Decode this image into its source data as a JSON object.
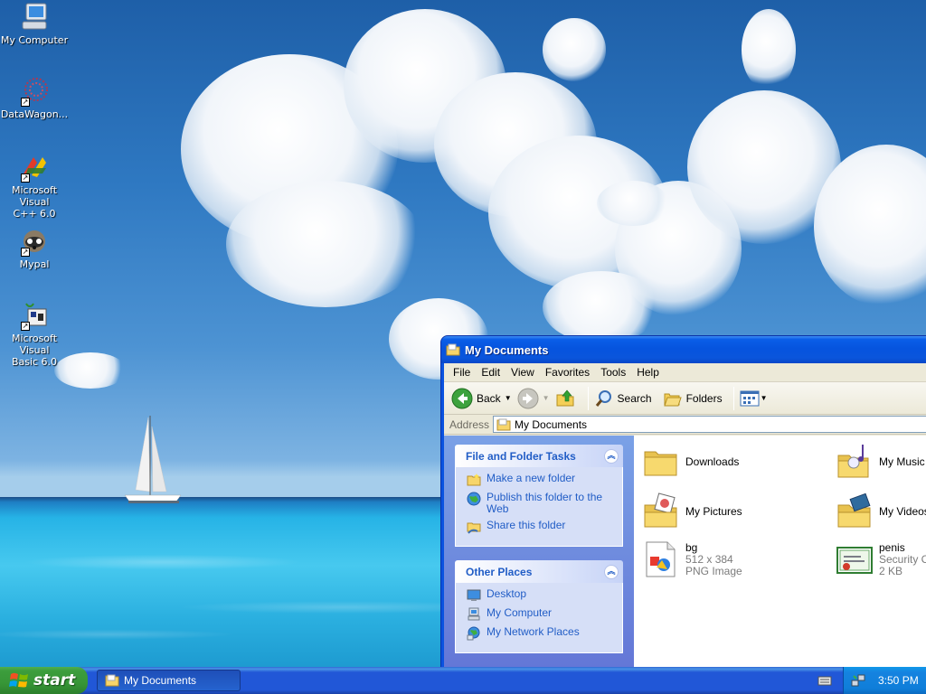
{
  "desktop": {
    "icons": [
      {
        "label": "My Computer",
        "icon": "my-computer-icon"
      },
      {
        "label": "DataWagon...",
        "icon": "datawagon-icon"
      },
      {
        "label_line1": "Microsoft Visual",
        "label_line2": "C++ 6.0",
        "icon": "visual-cpp-icon"
      },
      {
        "label": "Mypal",
        "icon": "mypal-icon"
      },
      {
        "label_line1": "Microsoft Visual",
        "label_line2": "Basic 6.0",
        "icon": "visual-basic-icon"
      }
    ]
  },
  "window": {
    "title": "My Documents",
    "menu": [
      "File",
      "Edit",
      "View",
      "Favorites",
      "Tools",
      "Help"
    ],
    "toolbar": {
      "back_label": "Back",
      "search_label": "Search",
      "folders_label": "Folders"
    },
    "address": {
      "label": "Address",
      "value": "My Documents"
    },
    "tasks_panel": {
      "title": "File and Folder Tasks",
      "items": [
        {
          "label": "Make a new folder",
          "icon": "new-folder-icon"
        },
        {
          "label": "Publish this folder to the Web",
          "icon": "publish-web-icon"
        },
        {
          "label": "Share this folder",
          "icon": "share-folder-icon"
        }
      ]
    },
    "places_panel": {
      "title": "Other Places",
      "items": [
        {
          "label": "Desktop",
          "icon": "desktop-icon"
        },
        {
          "label": "My Computer",
          "icon": "my-computer-icon"
        },
        {
          "label": "My Network Places",
          "icon": "network-places-icon"
        }
      ]
    },
    "files": [
      {
        "name": "Downloads",
        "type": "folder"
      },
      {
        "name": "My Music",
        "type": "music-folder"
      },
      {
        "name": "My Pictures",
        "type": "pictures-folder"
      },
      {
        "name": "My Videos",
        "type": "videos-folder"
      },
      {
        "name": "bg",
        "meta1": "512 x 384",
        "meta2": "PNG Image",
        "type": "png-file"
      },
      {
        "name": "penis",
        "meta1": "Security C",
        "meta2": "2 KB",
        "type": "certificate-file"
      }
    ]
  },
  "taskbar": {
    "start_label": "start",
    "task_button_label": "My Documents",
    "clock": "3:50 PM"
  },
  "colors": {
    "xp_blue": "#0a53e0",
    "task_link": "#215dc6",
    "start_green": "#3c9d3c"
  }
}
